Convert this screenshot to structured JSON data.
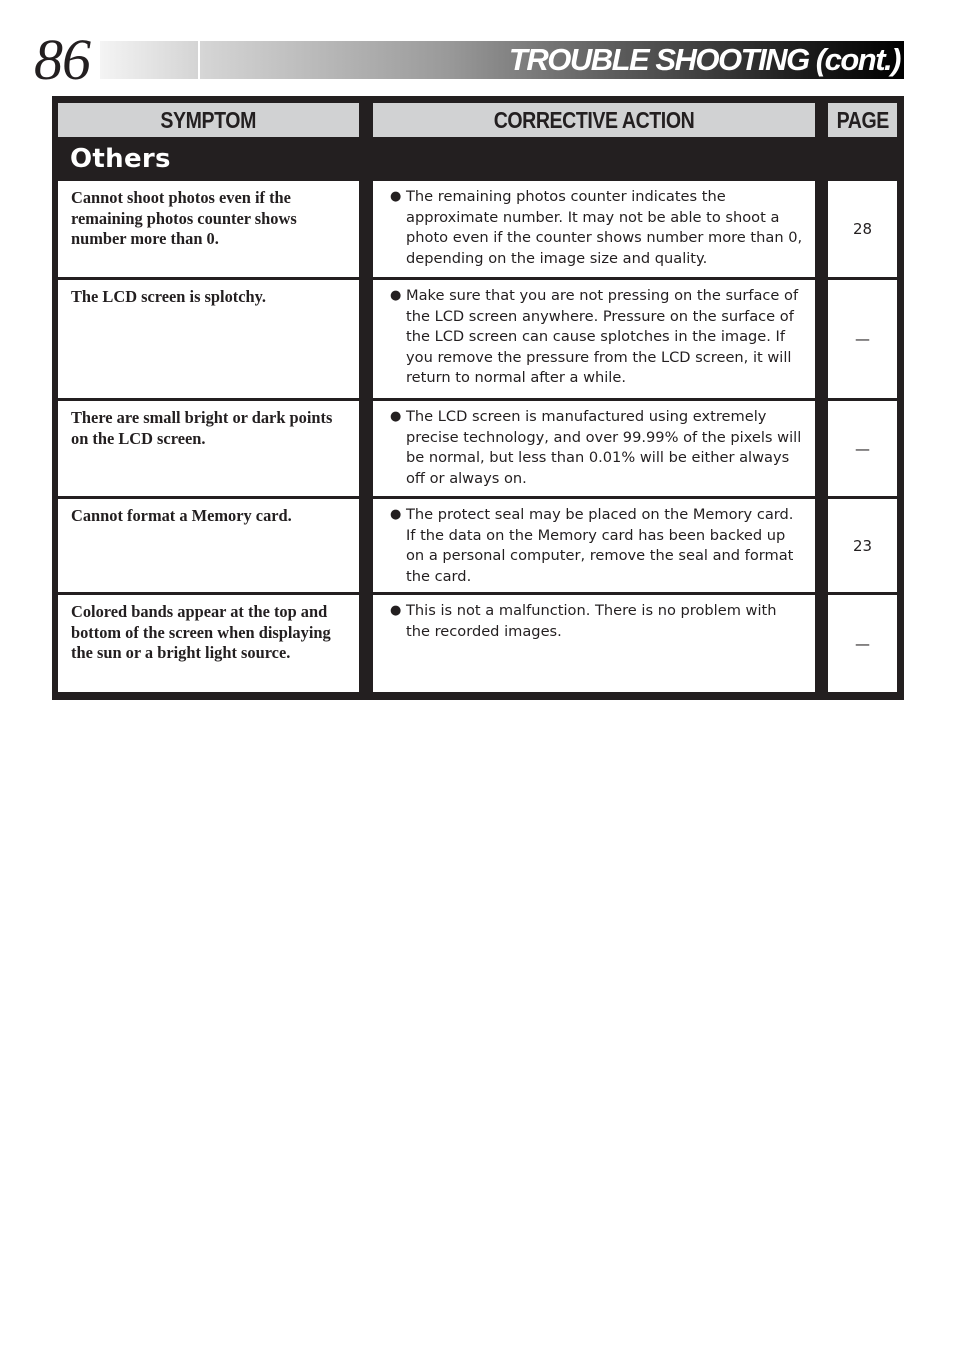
{
  "header": {
    "page_number": "86",
    "title": "TROUBLE SHOOTING (cont.)"
  },
  "table": {
    "columns": {
      "symptom": "SYMPTOM",
      "corrective_action": "CORRECTIVE ACTION",
      "page": "PAGE"
    },
    "section_title": "Others",
    "rows": [
      {
        "symptom": "Cannot shoot photos even if the remaining photos counter shows number more than 0.",
        "action": "The remaining photos counter indicates the approximate number. It may not be able to shoot a photo even if the counter shows number more than 0, depending on the image size and quality.",
        "page": "28"
      },
      {
        "symptom": "The LCD screen is splotchy.",
        "action": "Make sure that you are not pressing on the surface of the LCD screen anywhere. Pressure on the surface of the LCD screen can cause splotches in the image. If you remove the pressure from the LCD screen, it will return to normal after a while.",
        "page": "—"
      },
      {
        "symptom": "There are small bright or dark points on the LCD screen.",
        "action": "The LCD screen is manufactured using extremely precise technology, and over 99.99% of the pixels will be normal, but less than 0.01% will be either always off or always on.",
        "page": "—"
      },
      {
        "symptom": "Cannot format a Memory card.",
        "action": "The protect seal may be placed on the Memory card. If the data on the Memory card has been backed up on a personal computer, remove the seal and format the card.",
        "page": "23"
      },
      {
        "symptom": "Colored bands appear at the top and bottom of the screen when displaying the sun or a bright light source.",
        "action": "This is not a malfunction. There is no problem with the recorded images.",
        "page": "—"
      }
    ]
  }
}
